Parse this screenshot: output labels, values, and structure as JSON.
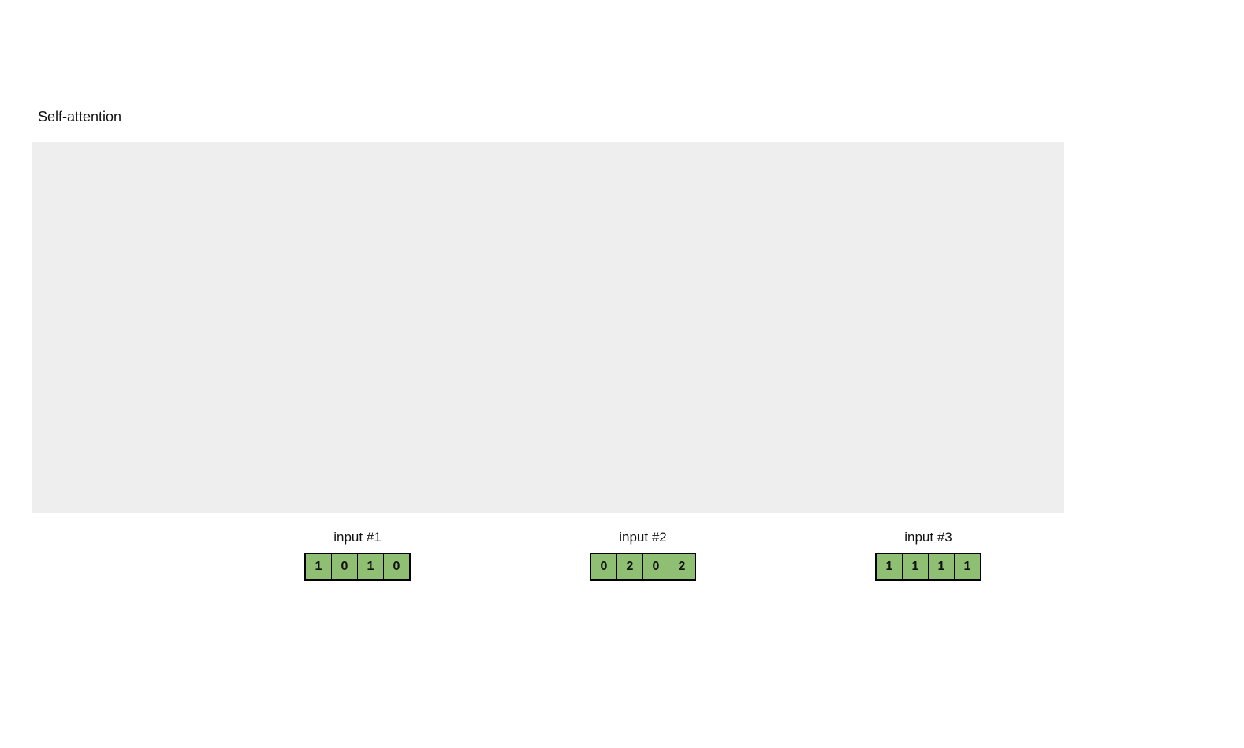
{
  "title": "Self-attention",
  "inputs": [
    {
      "label": "input #1",
      "values": [
        "1",
        "0",
        "1",
        "0"
      ]
    },
    {
      "label": "input #2",
      "values": [
        "0",
        "2",
        "0",
        "2"
      ]
    },
    {
      "label": "input #3",
      "values": [
        "1",
        "1",
        "1",
        "1"
      ]
    }
  ],
  "colors": {
    "cell_fill": "#8fbf73",
    "canvas_bg": "#eeeeee"
  }
}
